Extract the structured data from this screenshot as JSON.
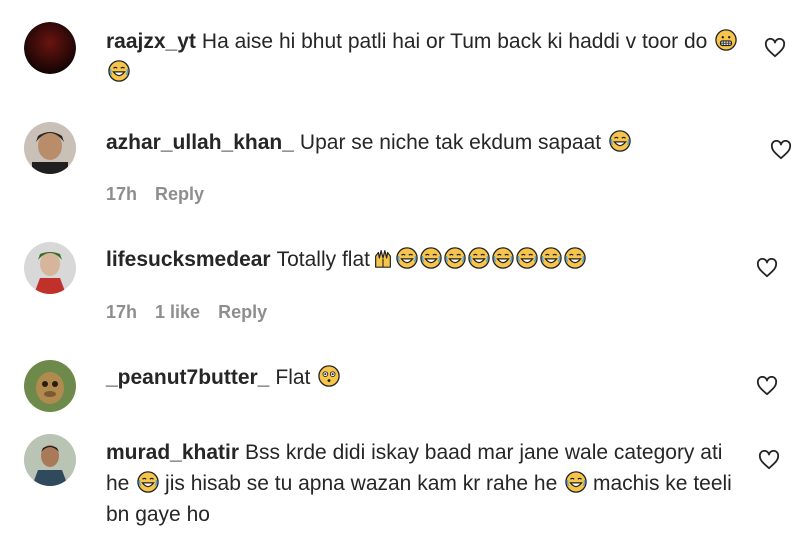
{
  "comments": [
    {
      "username": "raajzx_yt",
      "text": "Ha aise hi bhut patli hai or Tum back ki haddi v toor do",
      "emoji": [
        "grinning-face-icon",
        "joy-face-icon"
      ],
      "time": "",
      "likes": "",
      "reply": ""
    },
    {
      "username": "azhar_ullah_khan_",
      "text": "Upar se niche tak ekdum sapaat",
      "emoji": [
        "joy-face-icon"
      ],
      "time": "17h",
      "likes": "",
      "reply": "Reply"
    },
    {
      "username": "lifesucksmedear",
      "text": "Totally flat",
      "emoji": [
        "raised-hands-icon",
        "joy-face-icon",
        "joy-face-icon",
        "joy-face-icon",
        "joy-face-icon",
        "joy-face-icon",
        "joy-face-icon",
        "joy-face-icon",
        "joy-face-icon"
      ],
      "time": "17h",
      "likes": "1 like",
      "reply": "Reply"
    },
    {
      "username": "_peanut7butter_",
      "text": "Flat",
      "emoji": [
        "flushed-face-icon"
      ],
      "time": "",
      "likes": "",
      "reply": ""
    },
    {
      "username": "murad_khatir",
      "text_part1": "Bss krde didi iskay baad mar jane wale category ati he",
      "text_part2": "jis hisab se tu apna wazan kam kr rahe he",
      "text_part3": "machis ke teeli bn gaye ho",
      "emoji": [
        "joy-face-icon",
        "joy-face-icon"
      ],
      "time": "",
      "likes": "",
      "reply": ""
    }
  ],
  "colors": {
    "text": "#262626",
    "meta": "#8e8e8e",
    "emoji": "#f6c54a"
  }
}
